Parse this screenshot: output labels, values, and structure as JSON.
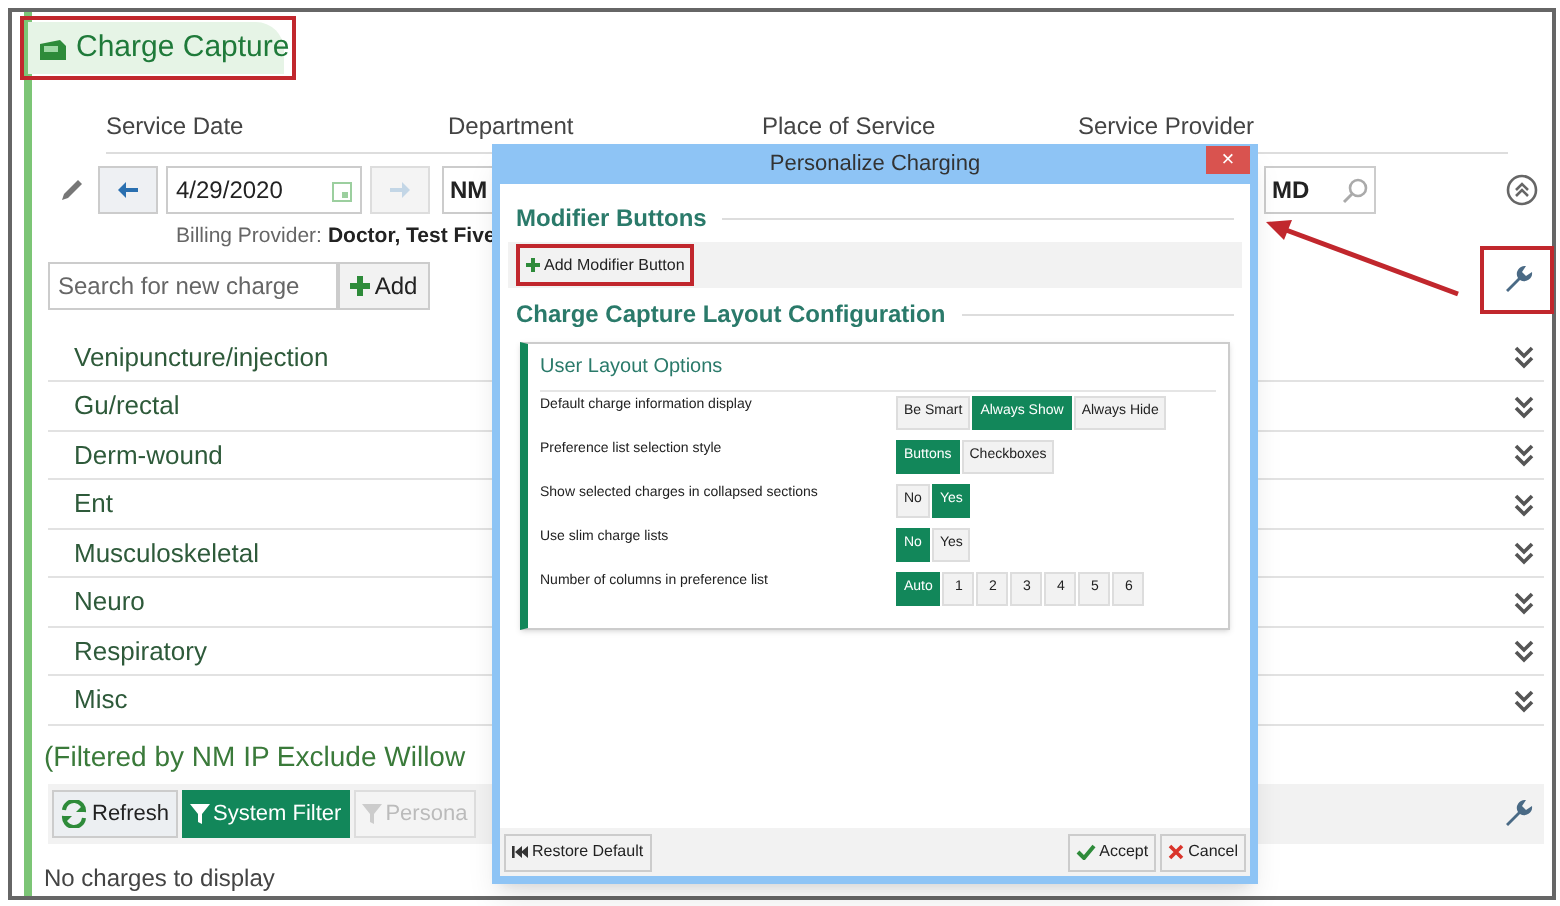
{
  "header": {
    "title": "Charge Capture"
  },
  "columns": [
    "Service Date",
    "Department",
    "Place of Service",
    "Service Provider"
  ],
  "service_date": {
    "value": "4/29/2020"
  },
  "department": {
    "value": "NM"
  },
  "provider": {
    "value": "MD"
  },
  "billing_provider": {
    "label": "Billing Provider:",
    "value": "Doctor, Test Five"
  },
  "search": {
    "placeholder": "Search for new charge",
    "add_button": "Add"
  },
  "sections": [
    {
      "label": "Venipuncture/injection"
    },
    {
      "label": "Gu/rectal"
    },
    {
      "label": "Derm-wound"
    },
    {
      "label": "Ent"
    },
    {
      "label": "Musculoskeletal"
    },
    {
      "label": "Neuro"
    },
    {
      "label": "Respiratory"
    },
    {
      "label": "Misc"
    }
  ],
  "filter_note": "(Filtered by NM IP Exclude Willow",
  "toolbar": [
    {
      "label": "Refresh",
      "kind": "refresh",
      "selected": false,
      "disabled": false
    },
    {
      "label": "System Filter",
      "kind": "filter",
      "selected": true,
      "disabled": false
    },
    {
      "label": "Persona",
      "kind": "filter",
      "selected": false,
      "disabled": true
    }
  ],
  "empty_message": "No charges to display",
  "dialog": {
    "title": "Personalize Charging",
    "close": "×",
    "modifier_heading": "Modifier Buttons",
    "add_modifier_button": "Add Modifier Button",
    "layout_heading": "Charge Capture Layout Configuration",
    "options_title": "User Layout Options",
    "options": [
      {
        "label": "Default charge information display",
        "choices": [
          {
            "label": "Be Smart",
            "selected": false
          },
          {
            "label": "Always Show",
            "selected": true
          },
          {
            "label": "Always Hide",
            "selected": false
          }
        ]
      },
      {
        "label": "Preference list selection style",
        "choices": [
          {
            "label": "Buttons",
            "selected": true
          },
          {
            "label": "Checkboxes",
            "selected": false
          }
        ]
      },
      {
        "label": "Show selected charges in collapsed sections",
        "choices": [
          {
            "label": "No",
            "selected": false
          },
          {
            "label": "Yes",
            "selected": true
          }
        ]
      },
      {
        "label": "Use slim charge lists",
        "choices": [
          {
            "label": "No",
            "selected": true
          },
          {
            "label": "Yes",
            "selected": false
          }
        ]
      },
      {
        "label": "Number of columns in preference list",
        "choices": [
          {
            "label": "Auto",
            "selected": true
          },
          {
            "label": "1",
            "selected": false
          },
          {
            "label": "2",
            "selected": false
          },
          {
            "label": "3",
            "selected": false
          },
          {
            "label": "4",
            "selected": false
          },
          {
            "label": "5",
            "selected": false
          },
          {
            "label": "6",
            "selected": false
          }
        ]
      }
    ],
    "restore_button": "Restore Default",
    "accept_button": "Accept",
    "cancel_button": "Cancel"
  }
}
